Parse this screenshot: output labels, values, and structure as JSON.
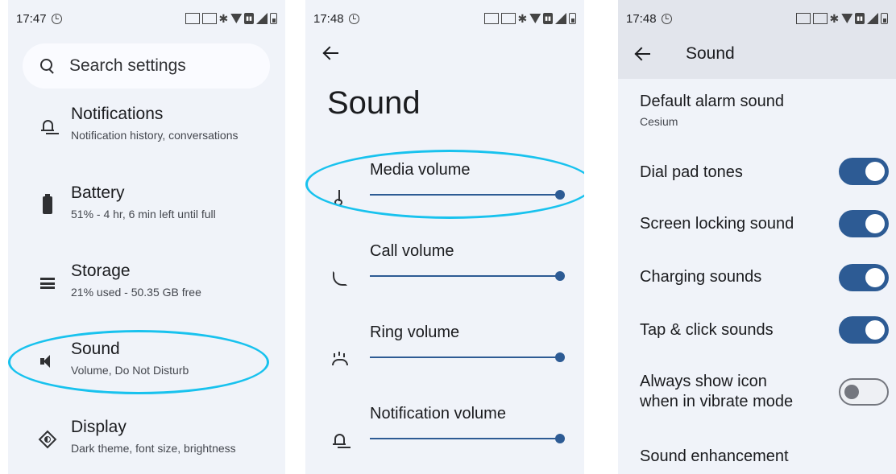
{
  "screen1": {
    "status": {
      "time": "17:47"
    },
    "search": {
      "placeholder": "Search settings"
    },
    "items": [
      {
        "title": "Notifications",
        "subtitle": "Notification history, conversations",
        "icon": "bell-icon"
      },
      {
        "title": "Battery",
        "subtitle": "51% - 4 hr, 6 min left until full",
        "icon": "battery-icon"
      },
      {
        "title": "Storage",
        "subtitle": "21% used - 50.35 GB free",
        "icon": "storage-icon"
      },
      {
        "title": "Sound",
        "subtitle": "Volume, Do Not Disturb",
        "icon": "speaker-icon"
      },
      {
        "title": "Display",
        "subtitle": "Dark theme, font size, brightness",
        "icon": "display-icon"
      }
    ]
  },
  "screen2": {
    "status": {
      "time": "17:48"
    },
    "title": "Sound",
    "volumes": [
      {
        "label": "Media volume",
        "level": 1.0,
        "icon": "music-note-icon"
      },
      {
        "label": "Call volume",
        "level": 1.0,
        "icon": "phone-icon"
      },
      {
        "label": "Ring volume",
        "level": 1.0,
        "icon": "ring-icon"
      },
      {
        "label": "Notification volume",
        "level": 1.0,
        "icon": "bell-icon"
      }
    ]
  },
  "screen3": {
    "status": {
      "time": "17:48"
    },
    "title": "Sound",
    "alarm": {
      "title": "Default alarm sound",
      "value": "Cesium"
    },
    "toggles": [
      {
        "label": "Dial pad tones",
        "on": true
      },
      {
        "label": "Screen locking sound",
        "on": true
      },
      {
        "label": "Charging sounds",
        "on": true
      },
      {
        "label": "Tap & click sounds",
        "on": true
      },
      {
        "label": "Always show icon when in vibrate mode",
        "on": false
      }
    ],
    "enhancement": {
      "title": "Sound enhancement"
    }
  },
  "colors": {
    "accent": "#2d5b94",
    "highlight": "#18c2ee",
    "background": "#f0f3f9"
  }
}
